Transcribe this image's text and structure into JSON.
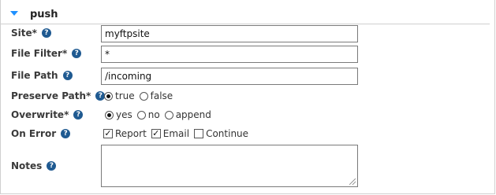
{
  "section": {
    "title": "push"
  },
  "fields": {
    "site": {
      "label": "Site*",
      "value": "myftpsite"
    },
    "file_filter": {
      "label": "File Filter*",
      "value": "*"
    },
    "file_path": {
      "label": "File Path",
      "value": "/incoming"
    },
    "preserve_path": {
      "label": "Preserve Path*",
      "options": [
        "true",
        "false"
      ],
      "selected": "true"
    },
    "overwrite": {
      "label": "Overwrite*",
      "options": [
        "yes",
        "no",
        "append"
      ],
      "selected": "yes"
    },
    "on_error": {
      "label": "On Error",
      "options": [
        {
          "label": "Report",
          "checked": true
        },
        {
          "label": "Email",
          "checked": true
        },
        {
          "label": "Continue",
          "checked": false
        }
      ]
    },
    "notes": {
      "label": "Notes",
      "value": ""
    }
  },
  "icons": {
    "help": "question-circle-icon",
    "collapse": "triangle-down-icon"
  },
  "colors": {
    "accent": "#1e90ff",
    "help_icon": "#1f5a91"
  }
}
